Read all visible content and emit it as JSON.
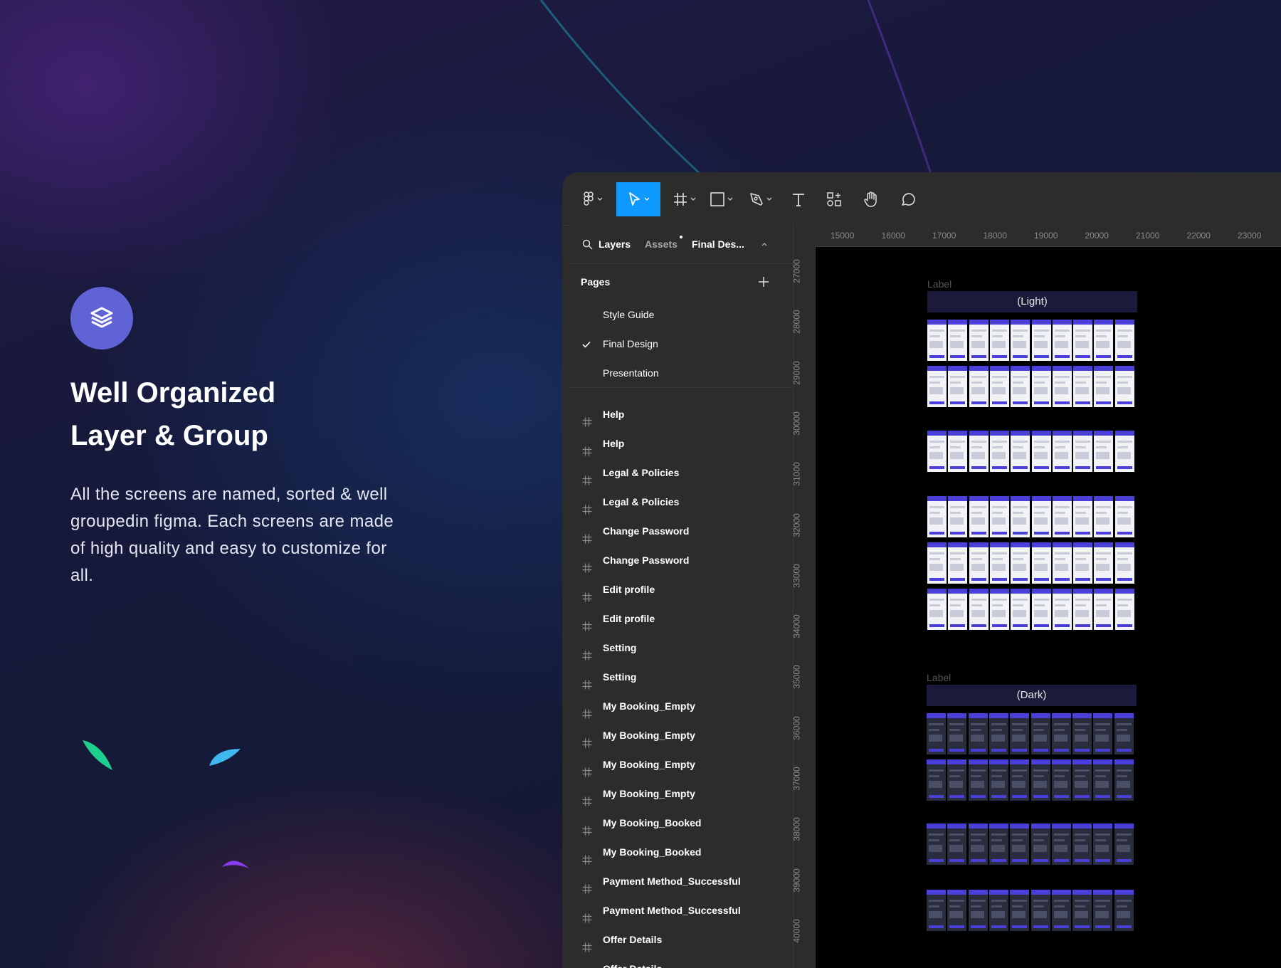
{
  "hero": {
    "icon": "layers-stack-icon",
    "title_line1": "Well Organized",
    "title_line2": "Layer & Group",
    "description": "All the screens are named, sorted & well groupedin figma. Each screens are made of high quality and easy to customize for all."
  },
  "colors": {
    "accent_blue": "#0d99ff",
    "hero_icon_bg": "#5f63d6",
    "panel_bg": "#2c2c2c",
    "canvas_bg": "#000000",
    "screen_accent": "#4a3fd8",
    "leaf_green": "#1fcf8f",
    "leaf_blue": "#3fb8f0",
    "leaf_purple": "#8a3df0"
  },
  "toolbar": {
    "tools": [
      "figma-menu-icon",
      "move-tool-icon",
      "frame-tool-icon",
      "rectangle-tool-icon",
      "pen-tool-icon",
      "text-tool-icon",
      "components-icon",
      "hand-tool-icon",
      "comment-icon"
    ]
  },
  "panel": {
    "tab_layers": "Layers",
    "tab_assets": "Assets",
    "page_selector": "Final Des...",
    "pages_label": "Pages",
    "pages": [
      {
        "label": "Style Guide",
        "selected": false
      },
      {
        "label": "Final Design",
        "selected": true
      },
      {
        "label": "Presentation",
        "selected": false
      }
    ],
    "layers": [
      "Help",
      "Help",
      "Legal & Policies",
      "Legal & Policies",
      "Change Password",
      "Change Password",
      "Edit profile",
      "Edit profile",
      "Setting",
      "Setting",
      "My Booking_Empty",
      "My Booking_Empty",
      "My Booking_Empty",
      "My Booking_Empty",
      "My Booking_Booked",
      "My Booking_Booked",
      "Payment Method_Successful",
      "Payment Method_Successful",
      "Offer Details",
      "Offer Details"
    ]
  },
  "rulers": {
    "top": [
      "15000",
      "16000",
      "17000",
      "18000",
      "19000",
      "20000",
      "21000",
      "22000",
      "23000"
    ],
    "left": [
      "27000",
      "28000",
      "29000",
      "30000",
      "31000",
      "32000",
      "33000",
      "34000",
      "35000",
      "36000",
      "37000",
      "38000",
      "39000",
      "40000"
    ]
  },
  "canvas": {
    "light_label": "Label",
    "light_title": "(Light)",
    "dark_label": "Label",
    "dark_title": "(Dark)"
  }
}
